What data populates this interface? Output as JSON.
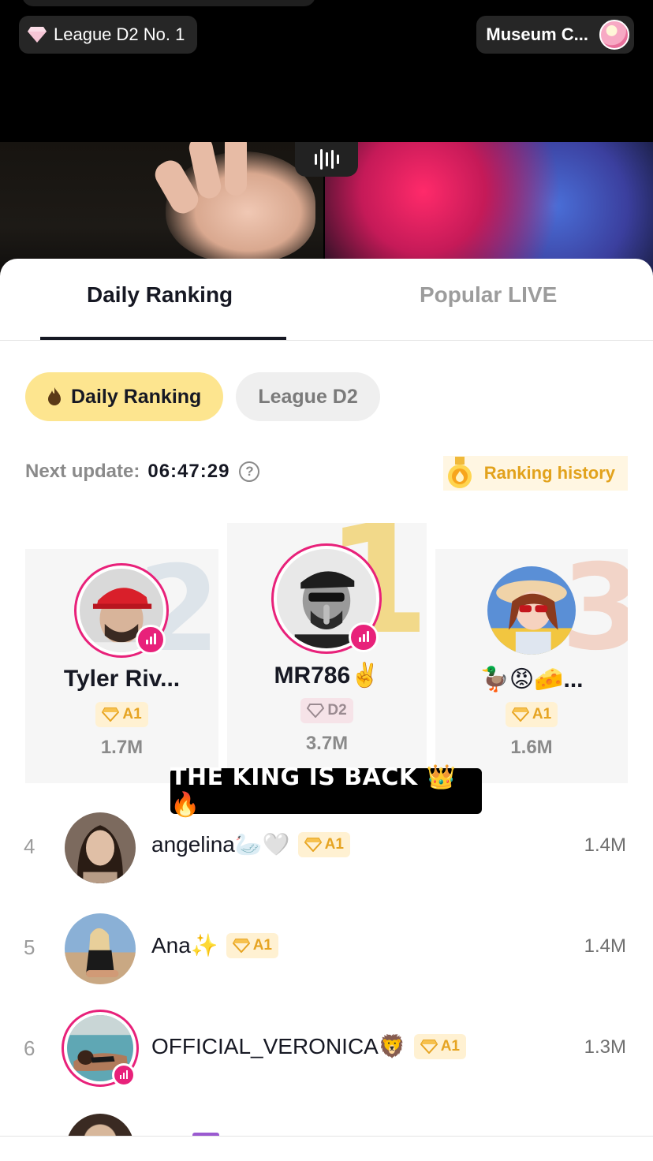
{
  "top": {
    "league_label": "League D2 No. 1",
    "host_name": "Museum C..."
  },
  "tabs": [
    {
      "label": "Daily Ranking",
      "active": true
    },
    {
      "label": "Popular LIVE",
      "active": false
    }
  ],
  "chips": [
    {
      "label": "Daily Ranking",
      "active": true
    },
    {
      "label": "League D2",
      "active": false
    }
  ],
  "update": {
    "label": "Next update:",
    "time": "06:47:29"
  },
  "history_label": "Ranking history",
  "podium": {
    "first": {
      "rank": "1",
      "name": "MR786✌️",
      "badge": "D2",
      "score": "3.7M",
      "live": true
    },
    "second": {
      "rank": "2",
      "name": "Tyler Riv...",
      "badge": "A1",
      "score": "1.7M",
      "live": true
    },
    "third": {
      "rank": "3",
      "name": "🦆😡🧀...",
      "badge": "A1",
      "score": "1.6M",
      "live": false
    }
  },
  "banner": "THE KING IS BACK 👑🔥",
  "list": [
    {
      "rank": "4",
      "name": "angelina🦢🤍",
      "badge": "A1",
      "score": "1.4M",
      "live": false
    },
    {
      "rank": "5",
      "name": "Ana✨",
      "badge": "A1",
      "score": "1.4M",
      "live": false
    },
    {
      "rank": "6",
      "name": "OFFICIAL_VERONICA🦁",
      "badge": "A1",
      "score": "1.3M",
      "live": true
    }
  ],
  "colors": {
    "accent_pink": "#e8217a",
    "chip_active": "#fde58f",
    "badge_gold": "#e6a422"
  },
  "icons": [
    "diamond-icon",
    "live-audio-icon",
    "flame-icon",
    "help-icon",
    "medal-icon",
    "live-indicator-icon"
  ]
}
